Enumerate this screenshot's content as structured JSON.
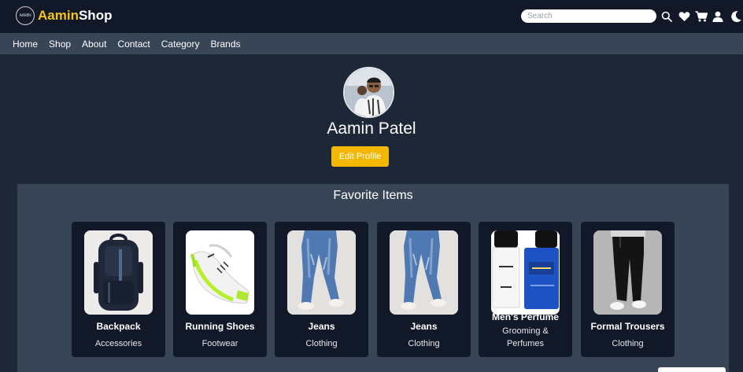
{
  "header": {
    "logo_badge_text": "AAMIN",
    "logo_part1": "Aamin",
    "logo_part2": "Shop",
    "search_placeholder": "Search",
    "icons": [
      "search-icon",
      "heart-icon",
      "cart-icon",
      "user-icon",
      "moon-icon"
    ],
    "accent_color": "#f5c518"
  },
  "nav": {
    "items": [
      "Home",
      "Shop",
      "About",
      "Contact",
      "Category",
      "Brands"
    ]
  },
  "profile": {
    "name": "Aamin Patel",
    "edit_label": "Edit Profile",
    "button_color": "#f5b800"
  },
  "favorites": {
    "title": "Favorite Items",
    "items": [
      {
        "name": "Backpack",
        "category": "Accessories",
        "image": "backpack-image"
      },
      {
        "name": "Running Shoes",
        "category": "Footwear",
        "image": "shoes-image"
      },
      {
        "name": "Jeans",
        "category": "Clothing",
        "image": "jeans-image"
      },
      {
        "name": "Jeans",
        "category": "Clothing",
        "image": "jeans-image"
      },
      {
        "name": "Men's Perfume",
        "category": "Grooming & Perfumes",
        "image": "perfume-image"
      },
      {
        "name": "Formal Trousers",
        "category": "Clothing",
        "image": "trousers-image"
      }
    ]
  }
}
